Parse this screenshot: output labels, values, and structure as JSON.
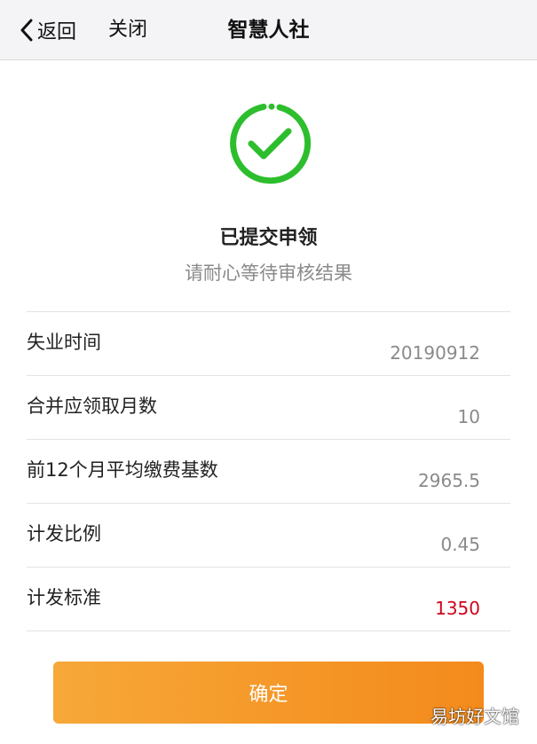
{
  "nav": {
    "back_label": "返回",
    "close_label": "关闭",
    "title": "智慧人社"
  },
  "status": {
    "icon": "check-circle-icon",
    "color": "#2dbe2d",
    "title": "已提交申领",
    "subtitle": "请耐心等待审核结果"
  },
  "info": {
    "rows": [
      {
        "label": "失业时间",
        "value": "20190912"
      },
      {
        "label": "合并应领取月数",
        "value": "10"
      },
      {
        "label": "前12个月平均缴费基数",
        "value": "2965.5"
      },
      {
        "label": "计发比例",
        "value": "0.45"
      },
      {
        "label": "计发标准",
        "value": "1350"
      }
    ]
  },
  "button": {
    "confirm_label": "确定"
  },
  "watermark": "易坊好文馆",
  "colors": {
    "accent_orange": "#f48a1c",
    "highlight_red": "#d0021b",
    "success_green": "#2dbe2d"
  }
}
